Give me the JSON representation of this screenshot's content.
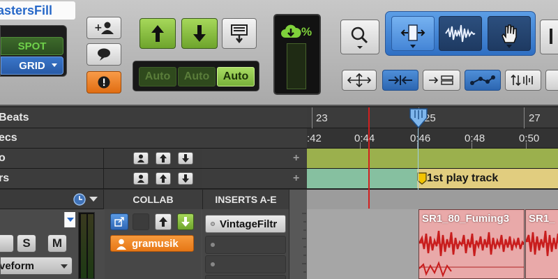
{
  "edit_modes": {
    "spot": "SPOT",
    "grid": "GRID"
  },
  "automation": {
    "buttons": [
      "Auto",
      "Auto",
      "Auto"
    ]
  },
  "cpu_meter": {
    "label": "%"
  },
  "rulers": {
    "bars_beats": {
      "label": "Beats",
      "ticks": [
        "23",
        "25",
        "27"
      ]
    },
    "min_secs": {
      "label": "ecs",
      "ticks": [
        ":42",
        "0:44",
        "0:46",
        "0:48",
        "0:50"
      ]
    },
    "tempo": {
      "label": "o"
    },
    "markers": {
      "label": "rs",
      "marker": "1st play track"
    }
  },
  "columns": {
    "collab": "COLLAB",
    "inserts": "INSERTS A-E"
  },
  "track": {
    "name": "astersFill",
    "solo": "S",
    "mute": "M",
    "view": "veform",
    "collab_user": "gramusik",
    "inserts": [
      "VintageFiltr",
      "",
      "",
      "",
      ""
    ]
  },
  "clips": [
    {
      "name": "SR1_80_Fuming3"
    },
    {
      "name": "SR1_"
    }
  ],
  "colors": {
    "accent_blue": "#2f6fc3",
    "automation_green": "#8cc63f",
    "collab_orange": "#f08a24",
    "clip_red": "#d62b2b",
    "playhead_red": "#d21f1f"
  }
}
